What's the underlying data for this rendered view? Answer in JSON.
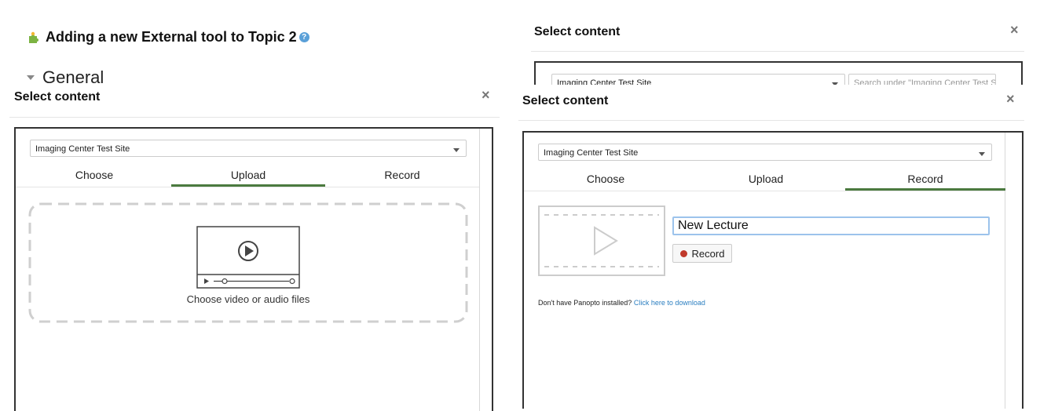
{
  "page": {
    "heading": "Adding a new External tool to Topic 2",
    "section": "General"
  },
  "left_dialog": {
    "title": "Select content",
    "site_select": "Imaging Center Test Site",
    "tabs": [
      "Choose",
      "Upload",
      "Record"
    ],
    "active_tab": "Upload",
    "dropzone_label": "Choose video or audio files"
  },
  "bg_dialog": {
    "title": "Select content",
    "site_select": "Imaging Center Test Site",
    "search_placeholder": "Search under \"Imaging Center Test S"
  },
  "right_dialog": {
    "title": "Select content",
    "site_select": "Imaging Center Test Site",
    "tabs": [
      "Choose",
      "Upload",
      "Record"
    ],
    "active_tab": "Record",
    "lecture_name": "New Lecture",
    "record_button": "Record",
    "install_prompt": "Don't have Panopto installed?",
    "download_link": "Click here to download"
  },
  "colors": {
    "accent_green": "#4b7a3f",
    "record_dot": "#c0392b",
    "link_blue": "#2a7ec0",
    "help_blue": "#5aa0d8",
    "puzzle_green": "#7cb342"
  }
}
